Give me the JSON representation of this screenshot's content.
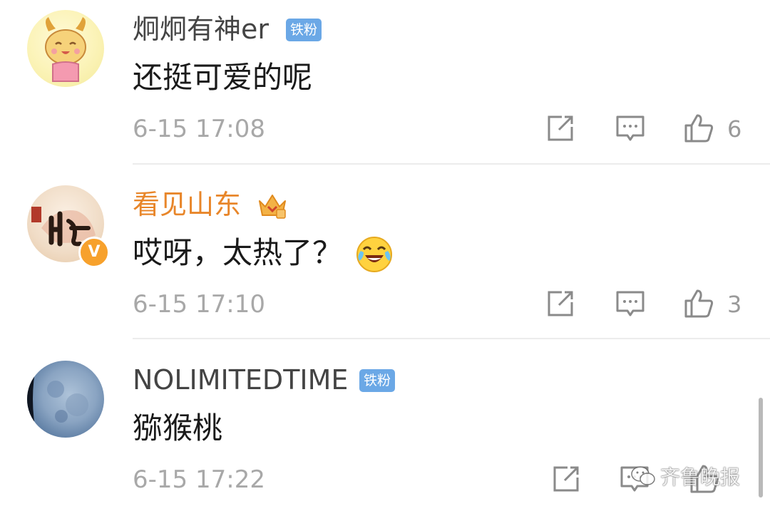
{
  "comments": [
    {
      "username": "炯炯有神er",
      "badge": "铁粉",
      "content": "还挺可爱的呢",
      "time": "6-15 17:08",
      "likes": "6"
    },
    {
      "username": "看见山东",
      "content": "哎呀，太热了？",
      "time": "6-15 17:10",
      "likes": "3",
      "verified_badge": "V",
      "emoji": "laughing-crying-emoji"
    },
    {
      "username": "NOLIMITEDTIME",
      "badge": "铁粉",
      "content": "猕猴桃",
      "time": "6-15 17:22"
    }
  ],
  "watermark": {
    "text": "齐鲁晚报"
  },
  "colors": {
    "verified_name": "#e8862a",
    "badge_bg": "#6ba8e6",
    "text_main": "#1a1a1a",
    "text_meta": "#a8a8a8"
  },
  "icons": {
    "repost": "repost-icon",
    "reply": "comment-icon",
    "like": "thumbs-up-icon"
  }
}
